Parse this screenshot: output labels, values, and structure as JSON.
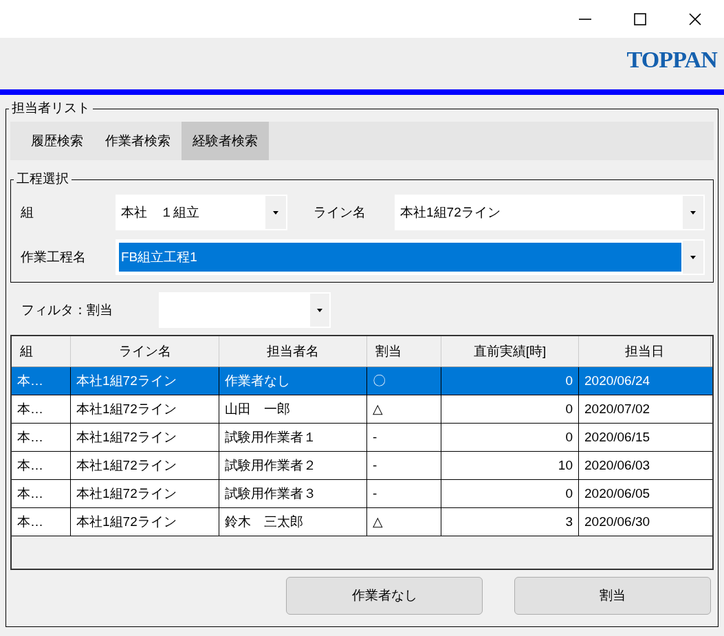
{
  "header": {
    "logo": "TOPPAN"
  },
  "panel": {
    "title": "担当者リスト",
    "tabs": [
      {
        "label": "履歴検索",
        "selected": false
      },
      {
        "label": "作業者検索",
        "selected": false
      },
      {
        "label": "経験者検索",
        "selected": true
      }
    ],
    "process_group": {
      "title": "工程選択",
      "fields": [
        {
          "label": "組",
          "value": "本社　１組立",
          "highlighted": false
        },
        {
          "label": "ライン名",
          "value": "本社1組72ライン",
          "highlighted": false
        },
        {
          "label": "作業工程名",
          "value": "FB組立工程1",
          "highlighted": true
        }
      ]
    },
    "filter": {
      "label": "フィルタ：割当"
    },
    "table": {
      "columns": [
        "組",
        "ライン名",
        "担当者名",
        "割当",
        "直前実績[時]",
        "担当日"
      ],
      "rows": [
        {
          "cells": [
            "本…",
            "本社1組72ライン",
            "作業者なし",
            "〇",
            "0",
            "2020/06/24"
          ],
          "selected": true
        },
        {
          "cells": [
            "本…",
            "本社1組72ライン",
            "山田　一郎",
            "△",
            "0",
            "2020/07/02"
          ],
          "selected": false
        },
        {
          "cells": [
            "本…",
            "本社1組72ライン",
            "試験用作業者１",
            "-",
            "0",
            "2020/06/15"
          ],
          "selected": false
        },
        {
          "cells": [
            "本…",
            "本社1組72ライン",
            "試験用作業者２",
            "-",
            "10",
            "2020/06/03"
          ],
          "selected": false
        },
        {
          "cells": [
            "本…",
            "本社1組72ライン",
            "試験用作業者３",
            "-",
            "0",
            "2020/06/05"
          ],
          "selected": false
        },
        {
          "cells": [
            "本…",
            "本社1組72ライン",
            "鈴木　三太郎",
            "△",
            "3",
            "2020/06/30"
          ],
          "selected": false
        }
      ]
    },
    "buttons": [
      "作業者なし",
      "割当"
    ]
  }
}
